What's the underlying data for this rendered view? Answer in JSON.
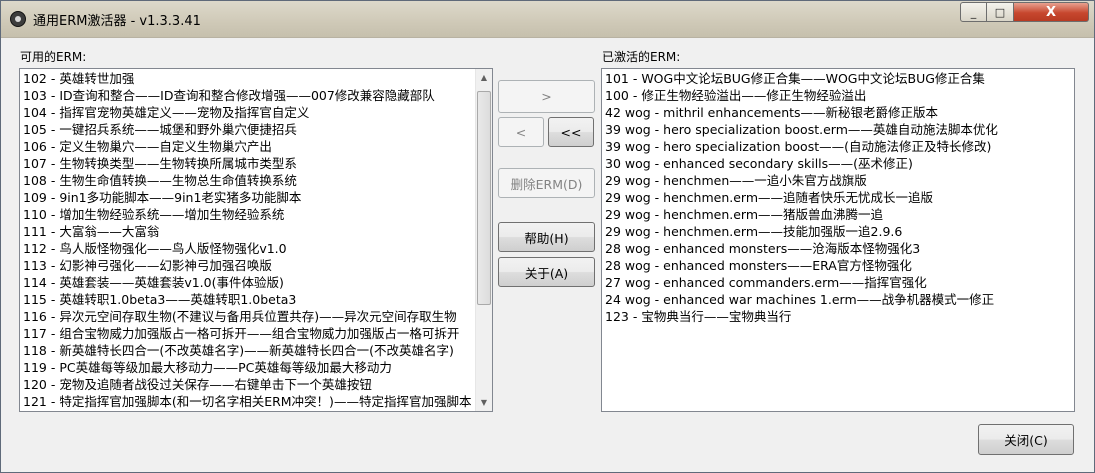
{
  "window": {
    "title": "通用ERM激活器 - v1.3.3.41",
    "controls": {
      "minimize": "_",
      "maximize": "□",
      "close": "X"
    }
  },
  "available": {
    "label": "可用的ERM:",
    "items": [
      "102 - 英雄转世加强",
      "103 - ID查询和整合——ID查询和整合修改增强——007修改兼容隐藏部队",
      "104 - 指挥官宠物英雄定义——宠物及指挥官自定义",
      "105 - 一键招兵系统——城堡和野外巢穴便捷招兵",
      "106 - 定义生物巢穴——自定义生物巢穴产出",
      "107 - 生物转换类型——生物转换所属城市类型系",
      "108 - 生物生命值转换——生物总生命值转换系统",
      "109 - 9in1多功能脚本——9in1老实猪多功能脚本",
      "110 - 增加生物经验系统——增加生物经验系统",
      "111 - 大富翁——大富翁",
      "112 - 鸟人版怪物强化——鸟人版怪物强化v1.0",
      "113 - 幻影神弓强化——幻影神弓加强召唤版",
      "114 - 英雄套装——英雄套装v1.0(事件体验版)",
      "115 - 英雄转职1.0beta3——英雄转职1.0beta3",
      "116 - 异次元空间存取生物(不建议与备用兵位置共存)——异次元空间存取生物",
      "117 - 组合宝物威力加强版占一格可拆开——组合宝物威力加强版占一格可拆开",
      "118 - 新英雄特长四合一(不改英雄名字)——新英雄特长四合一(不改英雄名字)",
      "119 - PC英雄每等级加最大移动力——PC英雄每等级加最大移动力",
      "120 - 宠物及追随者战役过关保存——右键单击下一个英雄按钮",
      "121 - 特定指挥官加强脚本(和一切名字相关ERM冲突！)——特定指挥官加强脚本"
    ]
  },
  "activated": {
    "label": "已激活的ERM:",
    "items": [
      "101 - WOG中文论坛BUG修正合集——WOG中文论坛BUG修正合集",
      "100 - 修正生物经验溢出——修正生物经验溢出",
      "42 wog - mithril enhancements——新秘银老爵修正版本",
      "39 wog - hero specialization boost.erm——英雄自动施法脚本优化",
      "39 wog - hero specialization boost——(自动施法修正及特长修改)",
      "30 wog - enhanced secondary skills——(巫术修正)",
      "29 wog - henchmen——一追小朱官方战旗版",
      "29 wog - henchmen.erm——追随者快乐无忧成长一追版",
      "29 wog - henchmen.erm——猪版兽血沸腾一追",
      "29 wog - henchmen.erm——技能加强版一追2.9.6",
      "28 wog - enhanced monsters——沧海版本怪物强化3",
      "28 wog - enhanced monsters——ERA官方怪物强化",
      "27 wog - enhanced commanders.erm——指挥官强化",
      "24 wog - enhanced war machines 1.erm——战争机器模式一修正",
      "123 - 宝物典当行——宝物典当行"
    ]
  },
  "buttons": {
    "add": ">",
    "remove": "<",
    "remove_all": "<<",
    "delete": "删除ERM(D)",
    "help": "帮助(H)",
    "about": "关于(A)",
    "close": "关闭(C)"
  }
}
